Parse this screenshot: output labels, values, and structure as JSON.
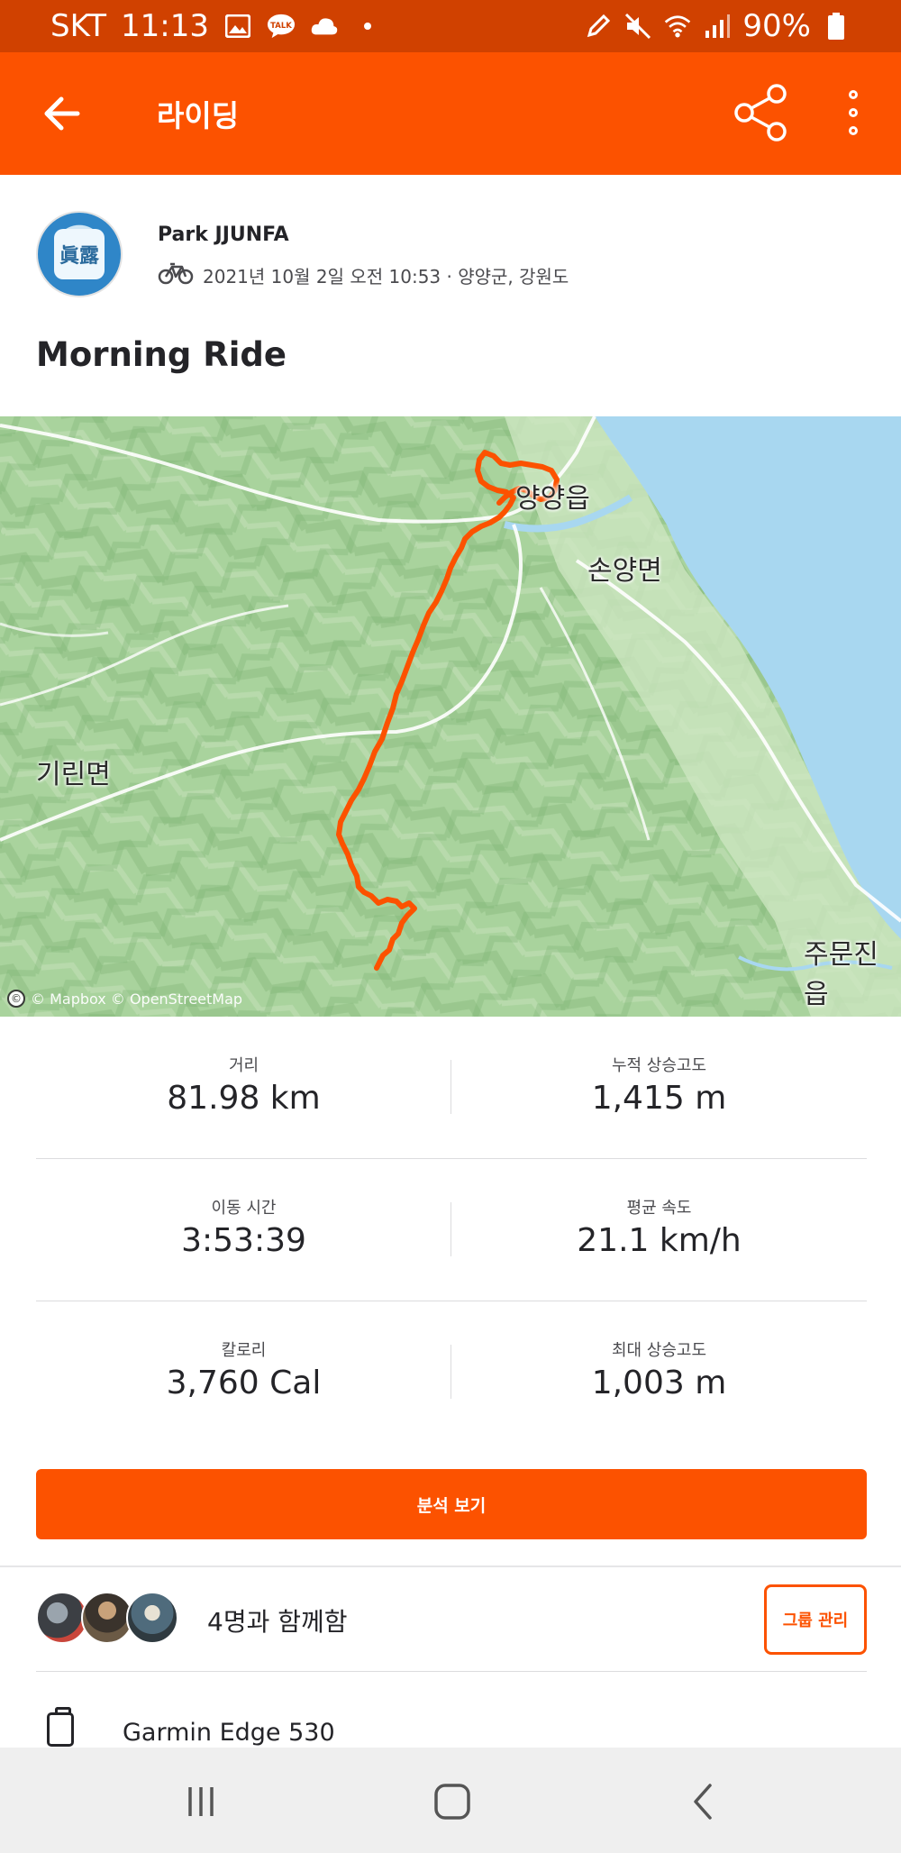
{
  "status_bar": {
    "carrier": "SKT",
    "time": "11:13",
    "talk_badge": "TALK",
    "battery": "90%"
  },
  "app_bar": {
    "title": "라이딩",
    "icons": [
      "back-arrow-icon",
      "share-icon",
      "more-vert-icon"
    ]
  },
  "activity": {
    "athlete_name": "Park JJUNFA",
    "avatar_text": "眞露",
    "meta": "2021년 10월 2일 오전 10:53 · 양양군, 강원도",
    "sport_icon": "bike-icon",
    "title": "Morning Ride"
  },
  "map": {
    "labels": {
      "yangyang": "양양읍",
      "sonyang": "손양면",
      "girin": "기린면",
      "jumunjin": "주문진읍"
    },
    "credit": "© Mapbox © OpenStreetMap",
    "credit_icon": "©",
    "route_color": "#fc5200",
    "sea_color": "#a8d7f0"
  },
  "stats": [
    {
      "left": {
        "label": "거리",
        "value": "81.98 km"
      },
      "right": {
        "label": "누적 상승고도",
        "value": "1,415 m"
      }
    },
    {
      "left": {
        "label": "이동 시간",
        "value": "3:53:39"
      },
      "right": {
        "label": "평균 속도",
        "value": "21.1 km/h"
      }
    },
    {
      "left": {
        "label": "칼로리",
        "value": "3,760 Cal"
      },
      "right": {
        "label": "최대 상승고도",
        "value": "1,003 m"
      }
    }
  ],
  "analysis_button": "분석 보기",
  "group": {
    "text": "4명과 함께함",
    "button": "그룹 관리"
  },
  "device": {
    "name": "Garmin Edge 530",
    "icon": "watch-icon"
  },
  "nav_bar": {
    "icons": [
      "recent-apps-icon",
      "home-icon",
      "back-icon"
    ]
  },
  "colors": {
    "brand": "#fc5200",
    "status_bar": "#d04100",
    "text": "#242428"
  }
}
